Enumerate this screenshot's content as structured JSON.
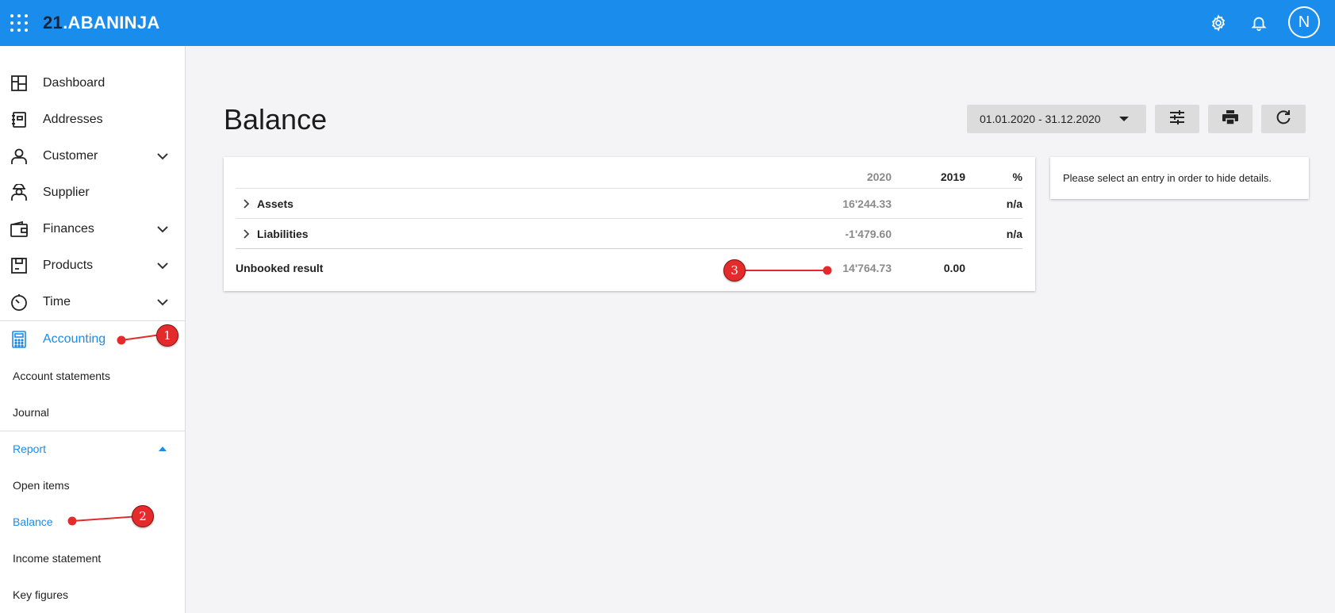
{
  "app": {
    "logo_num": "21",
    "logo_dot": ".",
    "logo_name": "ABANINJA",
    "avatar_initial": "N"
  },
  "sidebar": {
    "items": [
      {
        "label": "Dashboard",
        "icon": "dashboard-icon"
      },
      {
        "label": "Addresses",
        "icon": "address-book-icon"
      },
      {
        "label": "Customer",
        "icon": "customer-icon"
      },
      {
        "label": "Supplier",
        "icon": "supplier-icon"
      },
      {
        "label": "Finances",
        "icon": "wallet-icon"
      },
      {
        "label": "Products",
        "icon": "box-icon"
      },
      {
        "label": "Time",
        "icon": "stopwatch-icon"
      },
      {
        "label": "Accounting",
        "icon": "calculator-icon"
      }
    ],
    "accounting_sub": [
      "Account statements",
      "Journal"
    ],
    "report_label": "Report",
    "report_sub": [
      "Open items",
      "Balance",
      "Income statement",
      "Key figures"
    ]
  },
  "main": {
    "title": "Balance",
    "date_range": "01.01.2020 - 31.12.2020",
    "table": {
      "headers": {
        "y2020": "2020",
        "y2019": "2019",
        "pct": "%"
      },
      "rows": [
        {
          "label": "Assets",
          "y2020": "16'244.33",
          "y2019": "",
          "pct": "n/a"
        },
        {
          "label": "Liabilities",
          "y2020": "-1'479.60",
          "y2019": "",
          "pct": "n/a"
        }
      ],
      "total": {
        "label": "Unbooked result",
        "y2020": "14'764.73",
        "y2019": "0.00",
        "pct": ""
      }
    },
    "details_message": "Please select an entry in order to hide details."
  },
  "annotations": {
    "m1": "1",
    "m2": "2",
    "m3": "3"
  },
  "colors": {
    "accent": "#1a8cec",
    "marker": "#e42b2b"
  }
}
